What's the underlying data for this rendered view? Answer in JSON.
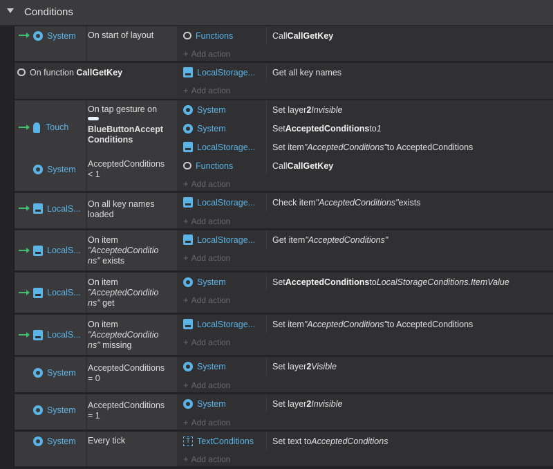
{
  "header": {
    "title": "Conditions"
  },
  "add_action_label": "Add action",
  "events": [
    {
      "conditions": [
        {
          "object": "System",
          "text": "On start of layout"
        }
      ],
      "actions": [
        {
          "object": "Functions",
          "text_pre": "Call ",
          "bold": "CallGetKey"
        }
      ]
    },
    {
      "function": {
        "prefix": "On function ",
        "name": "CallGetKey"
      },
      "actions": [
        {
          "object": "LocalStorage...",
          "text": "Get all key names"
        }
      ]
    },
    {
      "conditions": [
        {
          "object": "Touch",
          "text": "On tap gesture on",
          "target": "BlueButtonAccept Conditions"
        },
        {
          "object": "System",
          "text": "AcceptedConditions < 1"
        }
      ],
      "actions": [
        {
          "object": "System",
          "text_pre": "Set layer ",
          "bold": "2",
          "italic": " Invisible"
        },
        {
          "object": "System",
          "text_pre": "Set ",
          "bold": "AcceptedConditions",
          "mid": " to ",
          "italic": "1"
        },
        {
          "object": "LocalStorage...",
          "text_pre": "Set item ",
          "italic": "\"AcceptedConditions\"",
          "post": " to AcceptedConditions"
        },
        {
          "object": "Functions",
          "text_pre": "Call ",
          "bold": "CallGetKey"
        }
      ]
    },
    {
      "conditions": [
        {
          "object": "LocalS...",
          "text": "On all key names loaded"
        }
      ],
      "actions": [
        {
          "object": "LocalStorage...",
          "text_pre": "Check item ",
          "italic": "\"AcceptedConditions\"",
          "post": " exists"
        }
      ]
    },
    {
      "conditions": [
        {
          "object": "LocalS...",
          "text_pre": "On item",
          "italic": "\"AcceptedConditio ns\"",
          "post": " exists"
        }
      ],
      "actions": [
        {
          "object": "LocalStorage...",
          "text_pre": "Get item ",
          "italic": "\"AcceptedConditions\""
        }
      ]
    },
    {
      "conditions": [
        {
          "object": "LocalS...",
          "text_pre": "On item",
          "italic": "\"AcceptedConditio ns\"",
          "post": " get"
        }
      ],
      "actions": [
        {
          "object": "System",
          "text_pre": "Set ",
          "bold": "AcceptedConditions",
          "mid": " to ",
          "italic": "LocalStorageConditions.ItemValue"
        }
      ]
    },
    {
      "conditions": [
        {
          "object": "LocalS...",
          "text_pre": "On item",
          "italic": "\"AcceptedConditio ns\"",
          "post": " missing"
        }
      ],
      "actions": [
        {
          "object": "LocalStorage...",
          "text_pre": "Set item ",
          "italic": "\"AcceptedConditions\"",
          "post": " to AcceptedConditions"
        }
      ]
    },
    {
      "conditions": [
        {
          "object": "System",
          "text": "AcceptedConditions = 0"
        }
      ],
      "actions": [
        {
          "object": "System",
          "text_pre": "Set layer ",
          "bold": "2",
          "italic": " Visible"
        }
      ]
    },
    {
      "conditions": [
        {
          "object": "System",
          "text": "AcceptedConditions = 1"
        }
      ],
      "actions": [
        {
          "object": "System",
          "text_pre": "Set layer ",
          "bold": "2",
          "italic": " Invisible"
        }
      ]
    },
    {
      "conditions": [
        {
          "object": "System",
          "text": "Every tick"
        }
      ],
      "actions": [
        {
          "object": "TextConditions",
          "text_pre": "Set text to ",
          "italic": "AcceptedConditions"
        }
      ]
    }
  ]
}
